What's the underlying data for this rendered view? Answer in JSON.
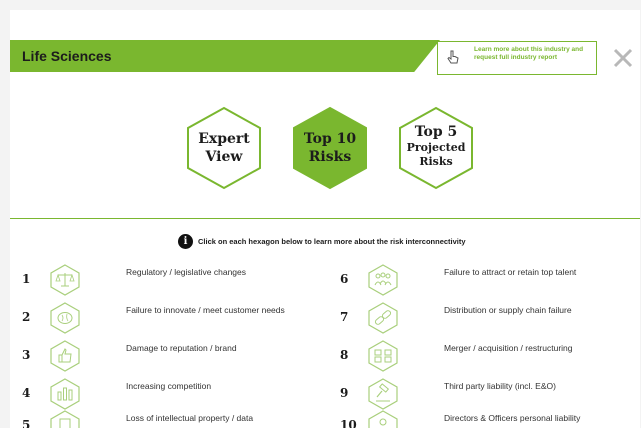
{
  "header": {
    "title": "Life Sciences"
  },
  "learn_more": {
    "text": "Learn more about this industry and request full industry report"
  },
  "hexagons": [
    {
      "label_line1": "Expert",
      "label_line2": "View",
      "label_line3": ""
    },
    {
      "label_line1": "Top 10",
      "label_line2": "Risks",
      "label_line3": ""
    },
    {
      "label_line1": "Top 5",
      "label_line2": "Projected",
      "label_line3": "Risks"
    }
  ],
  "hint": {
    "text": "Click on each hexagon below to learn more about the risk interconnectivity"
  },
  "risks": [
    {
      "num": "1",
      "label": "Regulatory / legislative changes",
      "icon": "scales-icon"
    },
    {
      "num": "2",
      "label": "Failure to innovate / meet customer needs",
      "icon": "brain-icon"
    },
    {
      "num": "3",
      "label": "Damage to reputation / brand",
      "icon": "thumbs-up-icon"
    },
    {
      "num": "4",
      "label": "Increasing competition",
      "icon": "bar-chart-icon"
    },
    {
      "num": "5",
      "label": "Loss of intellectual property / data",
      "icon": "document-icon"
    },
    {
      "num": "6",
      "label": "Failure to attract or retain top talent",
      "icon": "people-icon"
    },
    {
      "num": "7",
      "label": "Distribution or supply chain failure",
      "icon": "chain-link-icon"
    },
    {
      "num": "8",
      "label": "Merger / acquisition / restructuring",
      "icon": "merge-icon"
    },
    {
      "num": "9",
      "label": "Third party liability (incl. E&O)",
      "icon": "gavel-icon"
    },
    {
      "num": "10",
      "label": "Directors & Officers personal liability",
      "icon": "officer-icon"
    }
  ],
  "colors": {
    "accent": "#7ab72f",
    "text": "#1c1c1c"
  }
}
